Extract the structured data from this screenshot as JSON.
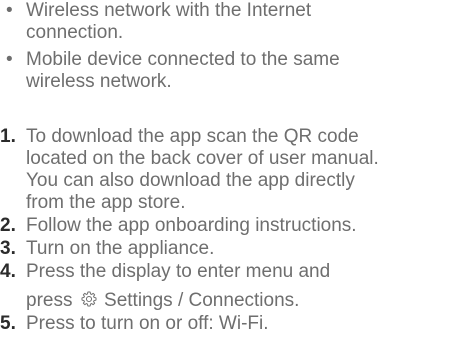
{
  "requirements": [
    {
      "bullet": "•",
      "lines": [
        "Wireless network with the Internet",
        "connection."
      ]
    },
    {
      "bullet": "•",
      "lines": [
        "Mobile device connected to the same",
        "wireless network."
      ]
    }
  ],
  "steps": [
    {
      "number": "1.",
      "lines": [
        "To download the app scan the QR code",
        "located on the back cover of user manual.",
        "You can also download the app directly",
        "from the app store."
      ]
    },
    {
      "number": "2.",
      "lines": [
        "Follow the app onboarding instructions."
      ]
    },
    {
      "number": "3.",
      "lines": [
        "Turn on the appliance."
      ]
    },
    {
      "number": "4.",
      "line1": "Press the display to enter menu and",
      "line2_prefix": "press",
      "line2_suffix": "Settings / Connections.",
      "icon": "settings-gear-icon"
    },
    {
      "number": "5.",
      "lines": [
        "Press to turn on or off: Wi-Fi."
      ]
    }
  ]
}
